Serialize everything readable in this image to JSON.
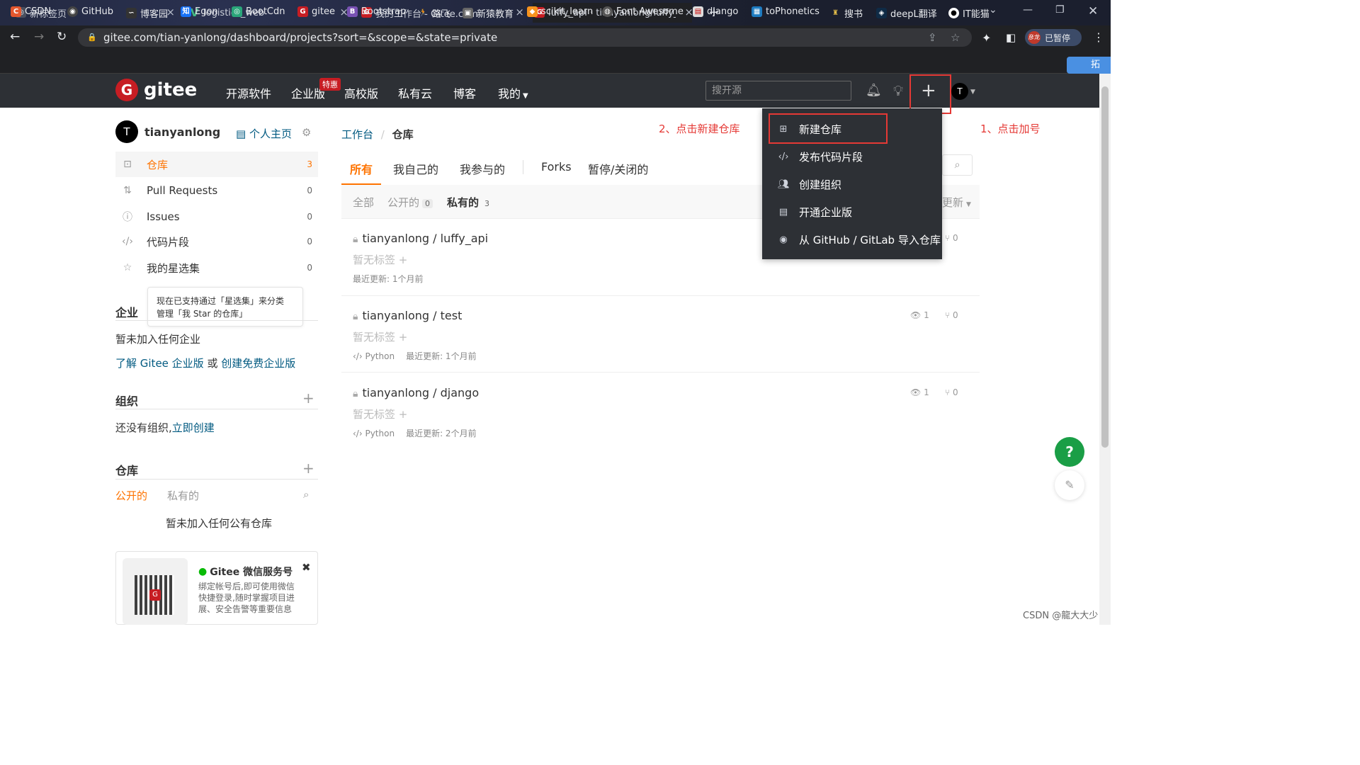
{
  "browser": {
    "tabs": [
      {
        "title": "新标签页",
        "icon": "chrome-icon"
      },
      {
        "title": "logistics_web",
        "icon": "vue-icon"
      },
      {
        "title": "我的工作台 - Gitee.com",
        "icon": "gitee-icon"
      },
      {
        "title": "luffy_api · tianyanlong/luffy_ap",
        "icon": "gitee-icon"
      }
    ],
    "url": "gitee.com/tian-yanlong/dashboard/projects?sort=&scope=&state=private",
    "profile_name": "彦龙",
    "paused_label": "已暂停",
    "bookmarks": [
      "CSDN",
      "GitHub",
      "博客园",
      "Egon",
      "BootCdn",
      "gitee",
      "Bootstrap",
      "路飞",
      "新猿教育",
      "scikit_learn",
      "Font Awesome",
      "django",
      "toPhonetics",
      "搜书",
      "deepL翻译",
      "IT能猫"
    ],
    "extra_bookmark": "拓"
  },
  "header": {
    "brand": "gitee",
    "nav": [
      "开源软件",
      "企业版",
      "高校版",
      "私有云",
      "博客",
      "我的"
    ],
    "hot_badge": "特惠",
    "search_placeholder": "搜开源",
    "avatar_letter": "T"
  },
  "sidebar": {
    "avatar_letter": "T",
    "username": "tianyanlong",
    "homepage_label": "个人主页",
    "items": [
      {
        "label": "仓库",
        "count": "3"
      },
      {
        "label": "Pull Requests",
        "count": "0"
      },
      {
        "label": "Issues",
        "count": "0"
      },
      {
        "label": "代码片段",
        "count": "0"
      },
      {
        "label": "我的星选集",
        "count": "0"
      }
    ],
    "tooltip_line1": "现在已支持通过「星选集」来分类",
    "tooltip_line2": "管理「我 Star 的仓库」",
    "enterprise_title": "企业",
    "enterprise_empty": "暂未加入任何企业",
    "enterprise_link1": "了解 Gitee 企业版",
    "enterprise_or": "或",
    "enterprise_link2": "创建免费企业版",
    "org_title": "组织",
    "org_empty": "还没有组织,",
    "org_create": "立即创建",
    "repo_title": "仓库",
    "repo_tab_public": "公开的",
    "repo_tab_private": "私有的",
    "repo_empty": "暂未加入任何公有仓库",
    "wechat_title": "Gitee 微信服务号",
    "wechat_desc1": "绑定帐号后,即可使用微信",
    "wechat_desc2": "快捷登录,随时掌握项目进",
    "wechat_desc3": "展、安全告警等重要信息"
  },
  "main": {
    "breadcrumb_root": "工作台",
    "breadcrumb_current": "仓库",
    "tabs": [
      "所有",
      "我自己的",
      "我参与的",
      "Forks",
      "暂停/关闭的"
    ],
    "filters": {
      "all": "全部",
      "public": "公开的",
      "public_count": "0",
      "private": "私有的",
      "private_count": "3",
      "sort": "更新"
    },
    "repos": [
      {
        "name": "tianyanlong / luffy_api",
        "tag": "暂无标签",
        "lang": "",
        "updated": "最近更新: 1个月前",
        "watch": "",
        "fork": "0"
      },
      {
        "name": "tianyanlong / test",
        "tag": "暂无标签",
        "lang": "Python",
        "updated": "最近更新: 1个月前",
        "watch": "1",
        "fork": "0"
      },
      {
        "name": "tianyanlong / django",
        "tag": "暂无标签",
        "lang": "Python",
        "updated": "最近更新: 2个月前",
        "watch": "1",
        "fork": "0"
      }
    ]
  },
  "dropdown": {
    "items": [
      "新建仓库",
      "发布代码片段",
      "创建组织",
      "开通企业版",
      "从 GitHub / GitLab 导入仓库"
    ]
  },
  "annotations": {
    "step1": "1、点击加号",
    "step2": "2、点击新建仓库"
  },
  "watermark": "CSDN @龍大大少",
  "colors": {
    "accent": "#fe7300",
    "brand_red": "#c71d23",
    "link": "#005980",
    "header_bg": "#2d3035",
    "annotation": "#e53935"
  }
}
